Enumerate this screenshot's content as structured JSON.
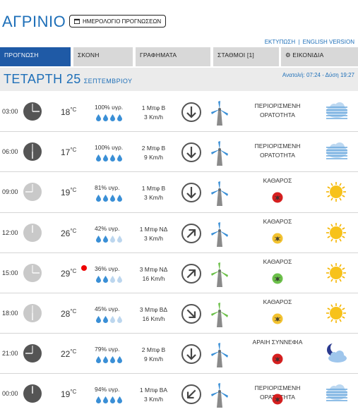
{
  "header": {
    "city": "ΑΓΡΙΝΙΟ",
    "calendar_button": "ΗΜΕΡΟΛΟΓΙΟ ΠΡΟΓΝΩΣΕΩΝ",
    "print_link": "ΕΚΤΥΠΩΣΗ",
    "separator": "|",
    "english_link": "ENGLISH VERSION"
  },
  "tabs": [
    {
      "label": "ΠΡΟΓΝΩΣΗ",
      "active": true
    },
    {
      "label": "ΣΚΟΝΗ",
      "active": false
    },
    {
      "label": "ΓΡΑΦΗΜΑΤΑ",
      "active": false
    },
    {
      "label": "ΣΤΑΘΜΟΙ [1]",
      "active": false
    },
    {
      "label": "ΕΙΚΟΝΙΔΙΑ",
      "active": false
    }
  ],
  "day": {
    "weekday": "ΤΕΤΑΡΤΗ 25",
    "month": "ΣΕΠΤΕΜΒΡΙΟΥ",
    "sun_times": "Ανατολή: 07:24 - Δύση 19:27"
  },
  "colors": {
    "accent": "#1e6fb8",
    "tab_active": "#1f5aa6",
    "tab_inactive": "#d8d8d8",
    "drop": "#3a8fd6",
    "badge_red": "#d61f1f",
    "badge_yellow": "#f2c230",
    "badge_green": "#6cc04a"
  },
  "forecast": [
    {
      "time": "03:00",
      "clock": "night",
      "temp": "18",
      "unit": "°C",
      "humidity": "100% υγρ.",
      "drops": 4,
      "wind_bf": "1 Μπφ Β",
      "wind_kmh": "3 Km/h",
      "arrow": "down",
      "turbine": "blue",
      "condition": [
        "ΠΕΡΙΟΡΙΣΜΕΝΗ",
        "ΟΡΑΤΟΤΗΤΑ"
      ],
      "badge": "none",
      "icon": "fog-icon"
    },
    {
      "time": "06:00",
      "clock": "night",
      "temp": "17",
      "unit": "°C",
      "humidity": "100% υγρ.",
      "drops": 4,
      "wind_bf": "2 Μπφ Β",
      "wind_kmh": "9 Km/h",
      "arrow": "down",
      "turbine": "blue",
      "condition": [
        "ΠΕΡΙΟΡΙΣΜΕΝΗ",
        "ΟΡΑΤΟΤΗΤΑ"
      ],
      "badge": "none",
      "icon": "fog-icon"
    },
    {
      "time": "09:00",
      "clock": "day",
      "temp": "19",
      "unit": "°C",
      "humidity": "81% υγρ.",
      "drops": 4,
      "wind_bf": "1 Μπφ Β",
      "wind_kmh": "3 Km/h",
      "arrow": "down",
      "turbine": "blue",
      "condition": [
        "ΚΑΘΑΡΟΣ"
      ],
      "badge": "red",
      "icon": "sun-icon"
    },
    {
      "time": "12:00",
      "clock": "day",
      "temp": "26",
      "unit": "°C",
      "humidity": "42% υγρ.",
      "drops": 2,
      "wind_bf": "1 Μπφ ΝΔ",
      "wind_kmh": "3 Km/h",
      "arrow": "up-right",
      "turbine": "blue",
      "condition": [
        "ΚΑΘΑΡΟΣ"
      ],
      "badge": "yellow",
      "icon": "sun-icon"
    },
    {
      "time": "15:00",
      "clock": "day",
      "temp": "29",
      "unit": "°C",
      "humidity": "36% υγρ.",
      "drops": 2,
      "wind_bf": "3 Μπφ ΝΔ",
      "wind_kmh": "16 Km/h",
      "arrow": "up-right",
      "turbine": "green",
      "condition": [
        "ΚΑΘΑΡΟΣ"
      ],
      "badge": "green",
      "icon": "sun-icon",
      "hot": true
    },
    {
      "time": "18:00",
      "clock": "day",
      "temp": "28",
      "unit": "°C",
      "humidity": "45% υγρ.",
      "drops": 2,
      "wind_bf": "3 Μπφ ΒΔ",
      "wind_kmh": "16 Km/h",
      "arrow": "down-right",
      "turbine": "green",
      "condition": [
        "ΚΑΘΑΡΟΣ"
      ],
      "badge": "yellow",
      "icon": "sun-icon"
    },
    {
      "time": "21:00",
      "clock": "night",
      "temp": "22",
      "unit": "°C",
      "humidity": "79% υγρ.",
      "drops": 4,
      "wind_bf": "2 Μπφ Β",
      "wind_kmh": "9 Km/h",
      "arrow": "down",
      "turbine": "blue",
      "condition": [
        "ΑΡΑΙΗ ΣΥΝΝΕΦΙΑ"
      ],
      "badge": "red",
      "icon": "moon-cloud-icon"
    },
    {
      "time": "00:00",
      "clock": "night",
      "temp": "19",
      "unit": "°C",
      "humidity": "94% υγρ.",
      "drops": 4,
      "wind_bf": "1 Μπφ ΒΑ",
      "wind_kmh": "3 Km/h",
      "arrow": "down-left",
      "turbine": "blue",
      "condition": [
        "ΠΕΡΙΟΡΙΣΜΕΝΗ",
        "ΟΡΑΤΟΤΗΤΑ"
      ],
      "badge": "red",
      "icon": "fog-icon"
    }
  ]
}
